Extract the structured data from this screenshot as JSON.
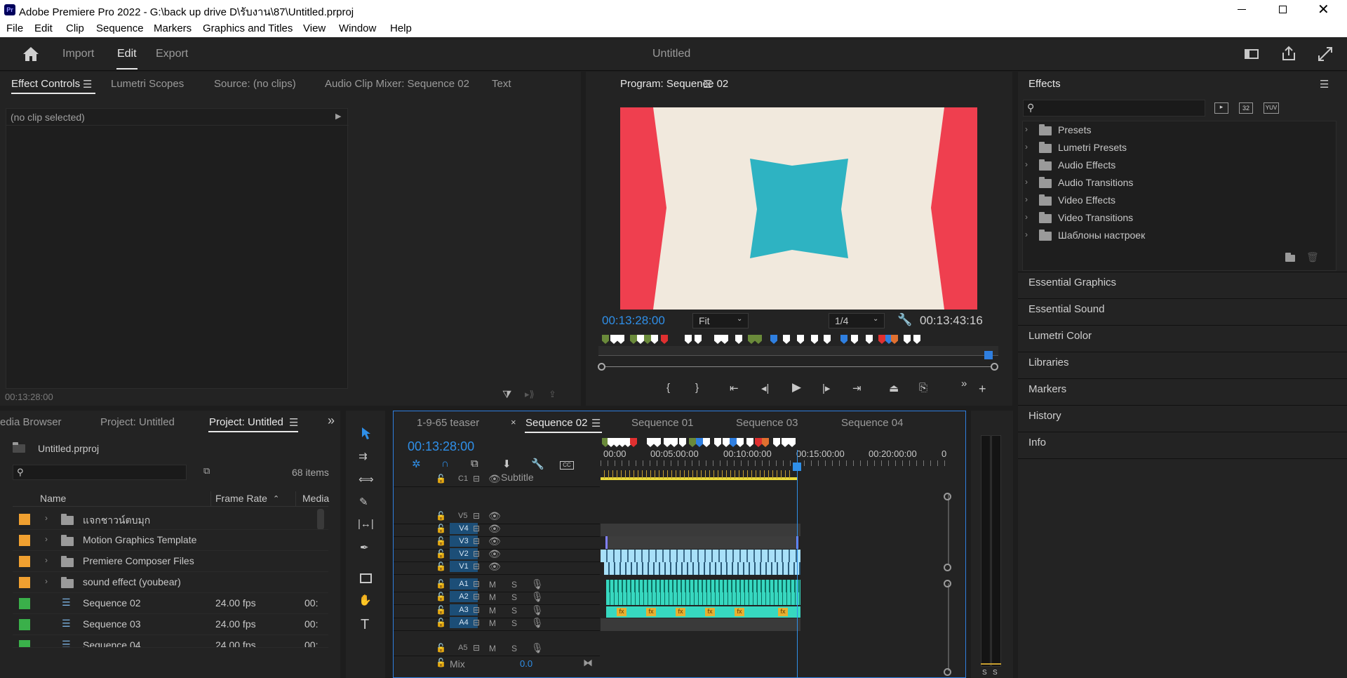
{
  "window": {
    "title": "Adobe Premiere Pro 2022 - G:\\back up drive D\\รับงาน\\87\\Untitled.prproj",
    "app_icon": "Pr",
    "controls": [
      "minimize-icon",
      "restore-icon",
      "close-icon"
    ]
  },
  "menu": [
    "File",
    "Edit",
    "Clip",
    "Sequence",
    "Markers",
    "Graphics and Titles",
    "View",
    "Window",
    "Help"
  ],
  "header": {
    "tabs": [
      "Import",
      "Edit",
      "Export"
    ],
    "active_tab": "Edit",
    "project_title": "Untitled"
  },
  "source_panel": {
    "tabs": [
      "Effect Controls",
      "Lumetri Scopes",
      "Source: (no clips)",
      "Audio Clip Mixer: Sequence 02",
      "Text"
    ],
    "no_clip": "(no clip selected)",
    "timecode": "00:13:28:00"
  },
  "program_monitor": {
    "title": "Program: Sequence 02",
    "timecode": "00:13:28:00",
    "fit": "Fit",
    "resolution": "1/4",
    "duration": "00:13:43:16",
    "transport": [
      "mark-in-icon",
      "mark-out-icon",
      "go-to-in-icon",
      "step-back-icon",
      "play-icon",
      "step-forward-icon",
      "go-to-out-icon",
      "lift-icon",
      "extract-icon"
    ],
    "colors": {
      "left_right": "#ef3f4f",
      "center": "#f1e9dd",
      "star": "#2eb3c2"
    }
  },
  "effects_panel": {
    "title": "Effects",
    "items": [
      "Presets",
      "Lumetri Presets",
      "Audio Effects",
      "Audio Transitions",
      "Video Effects",
      "Video Transitions",
      "Шаблоны настроек"
    ],
    "badges": [
      "32",
      "YUV"
    ]
  },
  "side_panels": [
    "Essential Graphics",
    "Essential Sound",
    "Lumetri Color",
    "Libraries",
    "Markers",
    "History",
    "Info"
  ],
  "project_panel": {
    "tabs": [
      "edia Browser",
      "Project: Untitled",
      "Project: Untitled"
    ],
    "file": "Untitled.prproj",
    "count": "68 items",
    "columns": [
      "Name",
      "Frame Rate",
      "Media"
    ],
    "rows": [
      {
        "name": "แจกชาวน์ตบมุก",
        "type": "folder",
        "color": "#f0a030",
        "fps": "",
        "media": ""
      },
      {
        "name": "Motion Graphics Template",
        "type": "folder",
        "color": "#f0a030",
        "fps": "",
        "media": ""
      },
      {
        "name": "Premiere Composer Files",
        "type": "folder",
        "color": "#f0a030",
        "fps": "",
        "media": ""
      },
      {
        "name": "sound effect (youbear)",
        "type": "folder",
        "color": "#f0a030",
        "fps": "",
        "media": ""
      },
      {
        "name": "Sequence 02",
        "type": "sequence",
        "color": "#3ab04a",
        "fps": "24.00 fps",
        "media": "00:"
      },
      {
        "name": "Sequence 03",
        "type": "sequence",
        "color": "#3ab04a",
        "fps": "24.00 fps",
        "media": "00:"
      },
      {
        "name": "Sequence 04",
        "type": "sequence",
        "color": "#3ab04a",
        "fps": "24.00 fps",
        "media": "00:"
      }
    ]
  },
  "timeline": {
    "tabs": [
      "1-9-65 teaser",
      "Sequence 02",
      "Sequence 01",
      "Sequence 03",
      "Sequence 04"
    ],
    "active_tab": "Sequence 02",
    "timecode": "00:13:28:00",
    "ruler": [
      "00:00",
      "00:05:00:00",
      "00:10:00:00",
      "00:15:00:00",
      "00:20:00:00",
      "0"
    ],
    "tracks_video": [
      "C1",
      "V5",
      "V4",
      "V3",
      "V2",
      "V1"
    ],
    "caption_label": "Subtitle",
    "tracks_audio": [
      "A1",
      "A2",
      "A3",
      "A4",
      "A5"
    ],
    "audio_buttons": [
      "M",
      "S"
    ],
    "mix_label": "Mix",
    "mix_value": "0.0"
  },
  "meter": {
    "labels": [
      "S",
      "S"
    ]
  }
}
